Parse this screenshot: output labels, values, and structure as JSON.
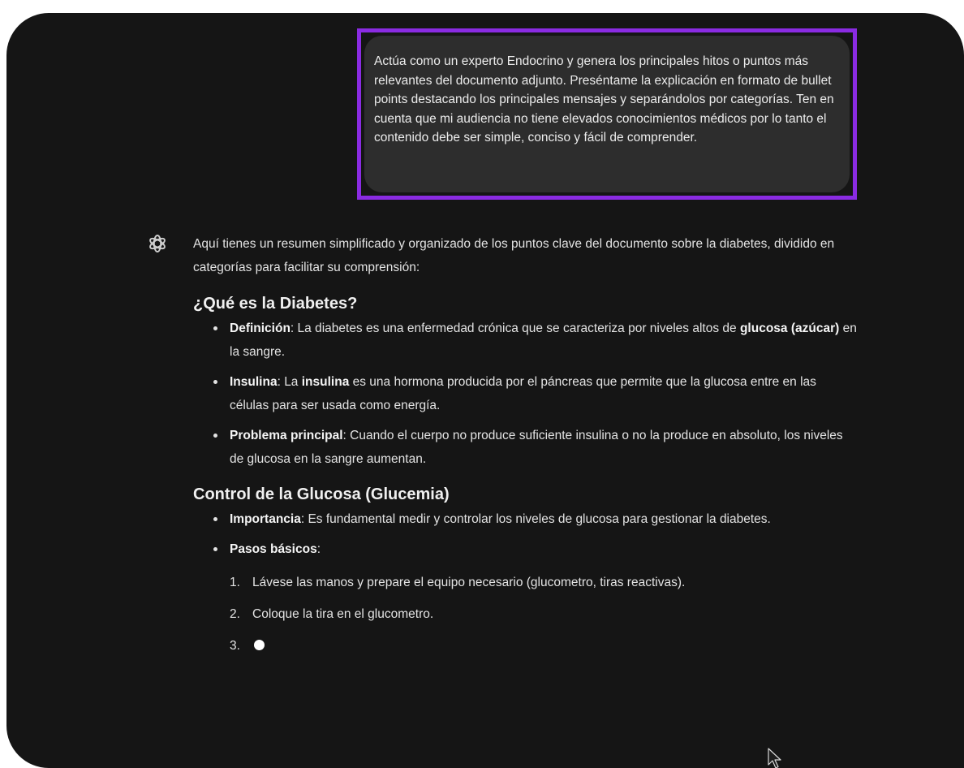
{
  "user_message": {
    "text": "Actúa como un experto Endocrino y genera los principales hitos o puntos más relevantes del documento adjunto. Preséntame la explicación en formato de bullet points destacando los principales mensajes y separándolos por categorías. Ten en cuenta que mi audiencia no tiene elevados conocimientos médicos por lo tanto el contenido debe ser simple, conciso y fácil de comprender."
  },
  "assistant": {
    "icon": "chatgpt-logo-icon",
    "intro": "Aquí tienes un resumen simplificado y organizado de los puntos clave del documento sobre la diabetes, dividido en categorías para facilitar su comprensión:",
    "sections": [
      {
        "heading": "¿Qué es la Diabetes?",
        "bullets": [
          {
            "term": "Definición",
            "text_a": ": La diabetes es una enfermedad crónica que se caracteriza por niveles altos de ",
            "bold_b": "glucosa (azúcar)",
            "text_c": " en la sangre."
          },
          {
            "term": "Insulina",
            "text_a": ": La ",
            "bold_b": "insulina",
            "text_c": " es una hormona producida por el páncreas que permite que la glucosa entre en las células para ser usada como energía."
          },
          {
            "term": "Problema principal",
            "text_a": ": Cuando el cuerpo no produce suficiente insulina o no la produce en absoluto, los niveles de glucosa en la sangre aumentan."
          }
        ]
      },
      {
        "heading": "Control de la Glucosa (Glucemia)",
        "bullets": [
          {
            "term": "Importancia",
            "text_a": ": Es fundamental medir y controlar los niveles de glucosa para gestionar la diabetes."
          },
          {
            "term": "Pasos básicos",
            "text_a": ":"
          }
        ],
        "steps": [
          {
            "num": "1.",
            "text": "Lávese las manos y prepare el equipo necesario (glucometro, tiras reactivas)."
          },
          {
            "num": "2.",
            "text": "Coloque la tira en el glucometro."
          },
          {
            "num": "3.",
            "text": ""
          }
        ]
      }
    ]
  },
  "colors": {
    "background": "#151515",
    "user_bubble": "#2d2d2d",
    "highlight_border": "#8a2be2"
  }
}
